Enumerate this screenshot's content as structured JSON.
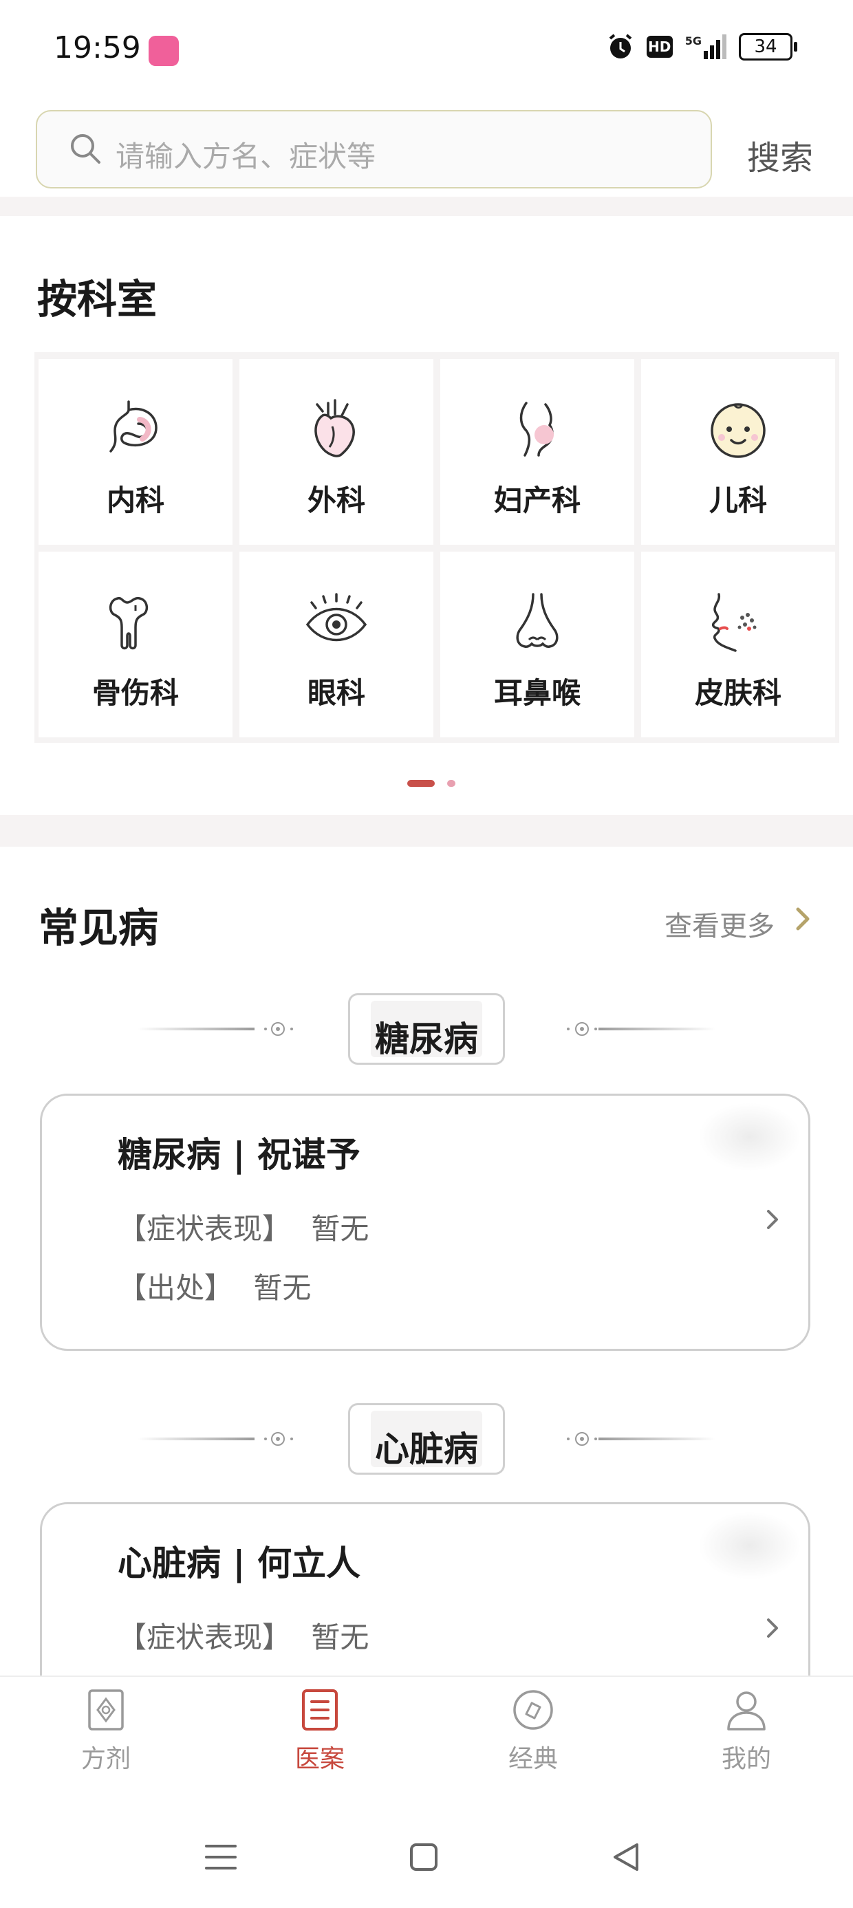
{
  "status_bar": {
    "time": "19:59",
    "battery": "34",
    "network": "5G",
    "hd": "HD"
  },
  "search": {
    "placeholder": "请输入方名、症状等",
    "button_label": "搜索"
  },
  "departments": {
    "title": "按科室",
    "items": [
      {
        "label": "内科",
        "icon": "stomach-icon"
      },
      {
        "label": "外科",
        "icon": "heart-icon"
      },
      {
        "label": "妇产科",
        "icon": "female-body-icon"
      },
      {
        "label": "儿科",
        "icon": "baby-face-icon"
      },
      {
        "label": "骨伤科",
        "icon": "bone-icon"
      },
      {
        "label": "眼科",
        "icon": "eye-icon"
      },
      {
        "label": "耳鼻喉",
        "icon": "nose-icon"
      },
      {
        "label": "皮肤科",
        "icon": "skin-icon"
      }
    ],
    "page_count": 2,
    "current_page": 1
  },
  "common_diseases": {
    "title": "常见病",
    "more_label": "查看更多",
    "groups": [
      {
        "tag": "糖尿病",
        "card": {
          "title": "糖尿病 | 祝谌予",
          "symptom_label": "【症状表现】",
          "symptom_value": "暂无",
          "source_label": "【出处】",
          "source_value": "暂无"
        }
      },
      {
        "tag": "心脏病",
        "card": {
          "title": "心脏病 | 何立人",
          "symptom_label": "【症状表现】",
          "symptom_value": "暂无"
        }
      }
    ]
  },
  "tabbar": {
    "items": [
      {
        "label": "方剂",
        "icon": "prescription-icon",
        "active": false
      },
      {
        "label": "医案",
        "icon": "case-list-icon",
        "active": true
      },
      {
        "label": "经典",
        "icon": "classic-icon",
        "active": false
      },
      {
        "label": "我的",
        "icon": "profile-icon",
        "active": false
      }
    ]
  },
  "colors": {
    "accent": "#c7483d",
    "inactive": "#9a9a9a",
    "page_bg": "#ffffff",
    "band": "#f6f3f3"
  }
}
